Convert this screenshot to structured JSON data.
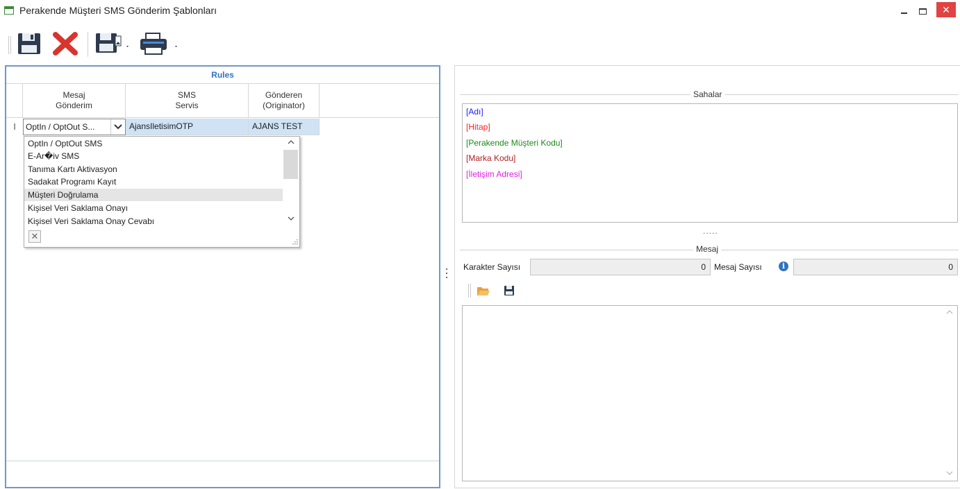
{
  "window": {
    "title": "Perakende Müşteri SMS Gönderim Şablonları",
    "controls": {
      "minimize": "–",
      "maximize": "□",
      "close": "✕"
    }
  },
  "toolbar": {
    "items": [
      {
        "name": "save-icon"
      },
      {
        "name": "delete-icon"
      },
      {
        "name": "save-as-icon",
        "has_dropdown": true
      },
      {
        "name": "print-icon",
        "has_dropdown": true
      }
    ]
  },
  "rules": {
    "title": "Rules",
    "columns": [
      {
        "line1": "Mesaj",
        "line2": "Gönderim"
      },
      {
        "line1": "SMS",
        "line2": "Servis"
      },
      {
        "line1": "Gönderen",
        "line2": "(Originator)"
      }
    ],
    "row": {
      "indicator": "I",
      "mesaj": "OptIn / OptOut S...",
      "sms": "AjansIletisimOTP",
      "originator": "AJANS TEST"
    },
    "dropdown": {
      "options": [
        "OptIn / OptOut SMS",
        "E-Ar�iv SMS",
        "Tanıma Kartı Aktivasyon",
        "Sadakat Programı Kayıt",
        "Müşteri Doğrulama",
        "Kişisel Veri Saklama Onayı",
        "Kişisel Veri Saklama Onay Cevabı"
      ],
      "highlighted": "Müşteri Doğrulama",
      "close_glyph": "✕"
    }
  },
  "splitter": {
    "glyph": "⋮"
  },
  "sahalar": {
    "title": "Sahalar",
    "fields": [
      {
        "label": "[Adı]",
        "color": "#1a1aff"
      },
      {
        "label": "[Hitap]",
        "color": "#ff2020"
      },
      {
        "label": "[Perakende Müşteri Kodu]",
        "color": "#1a8a1a"
      },
      {
        "label": "[Marka Kodu]",
        "color": "#b02020"
      },
      {
        "label": "[İletişim Adresi]",
        "color": "#e020e0"
      }
    ],
    "divider": "....."
  },
  "mesaj": {
    "title": "Mesaj",
    "karakter_label": "Karakter Sayısı",
    "karakter_value": "0",
    "mesaj_label": "Mesaj Sayısı",
    "mesaj_value": "0",
    "info_glyph": "i",
    "body": ""
  }
}
